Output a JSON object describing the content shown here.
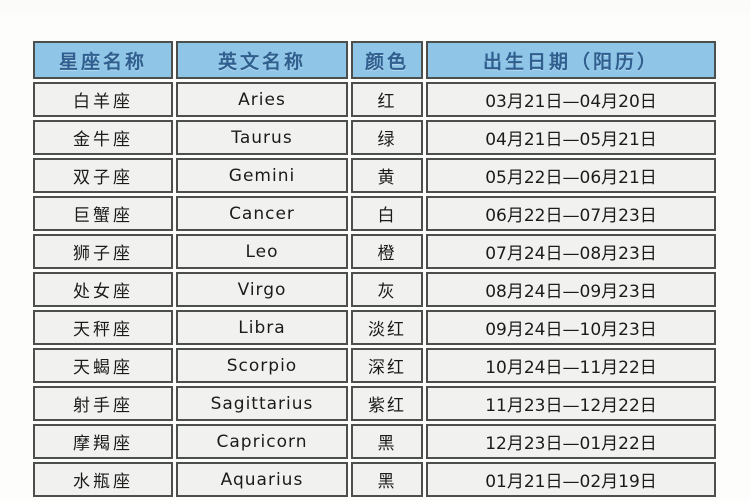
{
  "page": {
    "background_color": "#fdfdfc",
    "top_clipped_text": "· · · · ·     · ·     · · · ·"
  },
  "table": {
    "header_bg_color": "#8fc6e8",
    "header_text_color": "#2f5f8f",
    "cell_bg_color": "#f1f1ef",
    "border_color": "#4d4f4d",
    "columns": [
      {
        "key": "name",
        "label": "星座名称"
      },
      {
        "key": "en",
        "label": "英文名称"
      },
      {
        "key": "color",
        "label": "颜色"
      },
      {
        "key": "date",
        "label": "出生日期（阳历）"
      }
    ],
    "rows": [
      {
        "name": "白羊座",
        "en": "Aries",
        "color": "红",
        "date": "03月21日—04月20日"
      },
      {
        "name": "金牛座",
        "en": "Taurus",
        "color": "绿",
        "date": "04月21日—05月21日"
      },
      {
        "name": "双子座",
        "en": "Gemini",
        "color": "黄",
        "date": "05月22日—06月21日"
      },
      {
        "name": "巨蟹座",
        "en": "Cancer",
        "color": "白",
        "date": "06月22日—07月23日"
      },
      {
        "name": "狮子座",
        "en": "Leo",
        "color": "橙",
        "date": "07月24日—08月23日"
      },
      {
        "name": "处女座",
        "en": "Virgo",
        "color": "灰",
        "date": "08月24日—09月23日"
      },
      {
        "name": "天秤座",
        "en": "Libra",
        "color": "淡红",
        "date": "09月24日—10月23日"
      },
      {
        "name": "天蝎座",
        "en": "Scorpio",
        "color": "深红",
        "date": "10月24日—11月22日"
      },
      {
        "name": "射手座",
        "en": "Sagittarius",
        "color": "紫红",
        "date": "11月23日—12月22日"
      },
      {
        "name": "摩羯座",
        "en": "Capricorn",
        "color": "黑",
        "date": "12月23日—01月22日"
      },
      {
        "name": "水瓶座",
        "en": "Aquarius",
        "color": "黑",
        "date": "01月21日—02月19日"
      }
    ]
  }
}
